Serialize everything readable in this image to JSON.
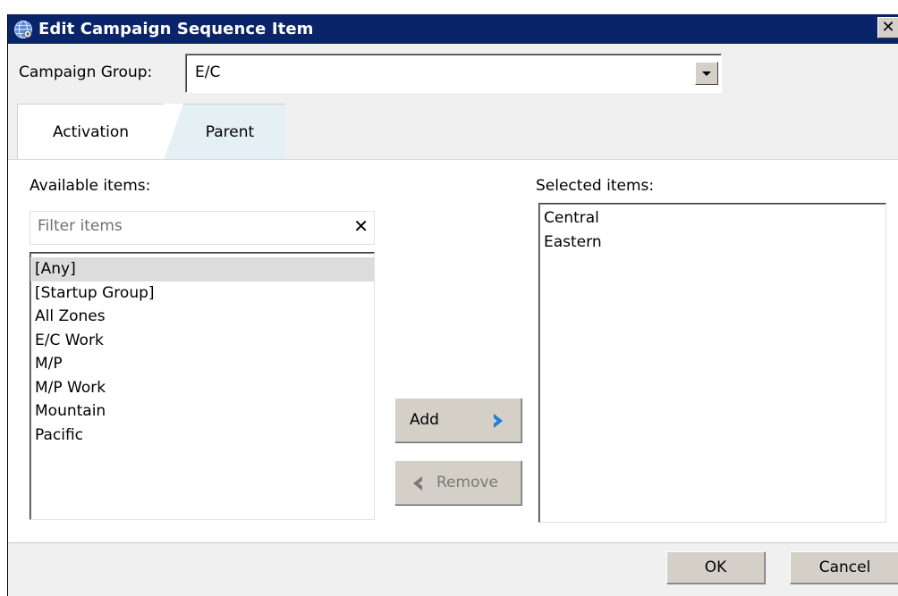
{
  "window": {
    "title": "Edit Campaign Sequence Item",
    "close_glyph": "✕"
  },
  "campaign_group": {
    "label": "Campaign Group:",
    "value": "E/C"
  },
  "tabs": [
    {
      "label": "Activation",
      "active": true
    },
    {
      "label": "Parent",
      "active": false
    }
  ],
  "available": {
    "label": "Available items:",
    "filter_placeholder": "Filter items",
    "clear_glyph": "✕",
    "items": [
      "[Any]",
      "[Startup Group]",
      "All Zones",
      "E/C Work",
      "M/P",
      "M/P Work",
      "Mountain",
      "Pacific"
    ],
    "selected_index": 0
  },
  "selected": {
    "label": "Selected items:",
    "items": [
      "Central",
      "Eastern"
    ]
  },
  "buttons": {
    "add": "Add",
    "remove": "Remove",
    "ok": "OK",
    "cancel": "Cancel"
  },
  "colors": {
    "titlebar": "#0a246a",
    "accent_arrow": "#1e7fd8",
    "disabled_arrow": "#7a7a7a",
    "tab_inactive": "#e4f0f4"
  }
}
